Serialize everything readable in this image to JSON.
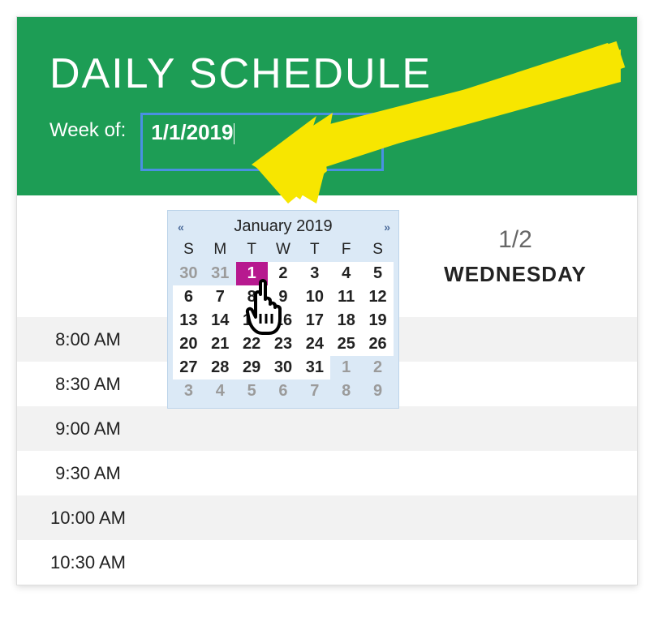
{
  "header": {
    "title": "DAILY SCHEDULE",
    "weekof_label": "Week of:",
    "date_value": "1/1/2019"
  },
  "calendar": {
    "prev_label": "«",
    "next_label": "»",
    "month_title": "January 2019",
    "dow": [
      "S",
      "M",
      "T",
      "W",
      "T",
      "F",
      "S"
    ],
    "days": [
      {
        "n": "30",
        "other": true
      },
      {
        "n": "31",
        "other": true
      },
      {
        "n": "1",
        "selected": true
      },
      {
        "n": "2"
      },
      {
        "n": "3"
      },
      {
        "n": "4"
      },
      {
        "n": "5"
      },
      {
        "n": "6"
      },
      {
        "n": "7"
      },
      {
        "n": "8"
      },
      {
        "n": "9"
      },
      {
        "n": "10"
      },
      {
        "n": "11"
      },
      {
        "n": "12"
      },
      {
        "n": "13"
      },
      {
        "n": "14"
      },
      {
        "n": "15"
      },
      {
        "n": "16"
      },
      {
        "n": "17"
      },
      {
        "n": "18"
      },
      {
        "n": "19"
      },
      {
        "n": "20"
      },
      {
        "n": "21"
      },
      {
        "n": "22"
      },
      {
        "n": "23"
      },
      {
        "n": "24"
      },
      {
        "n": "25"
      },
      {
        "n": "26"
      },
      {
        "n": "27"
      },
      {
        "n": "28"
      },
      {
        "n": "29"
      },
      {
        "n": "30"
      },
      {
        "n": "31"
      },
      {
        "n": "1",
        "other": true
      },
      {
        "n": "2",
        "other": true
      },
      {
        "n": "3",
        "other": true
      },
      {
        "n": "4",
        "other": true
      },
      {
        "n": "5",
        "other": true
      },
      {
        "n": "6",
        "other": true
      },
      {
        "n": "7",
        "other": true
      },
      {
        "n": "8",
        "other": true
      },
      {
        "n": "9",
        "other": true
      }
    ]
  },
  "columns": {
    "right": {
      "date": "1/2",
      "day": "WEDNESDAY"
    }
  },
  "times": [
    "8:00 AM",
    "8:30 AM",
    "9:00 AM",
    "9:30 AM",
    "10:00 AM",
    "10:30 AM"
  ]
}
